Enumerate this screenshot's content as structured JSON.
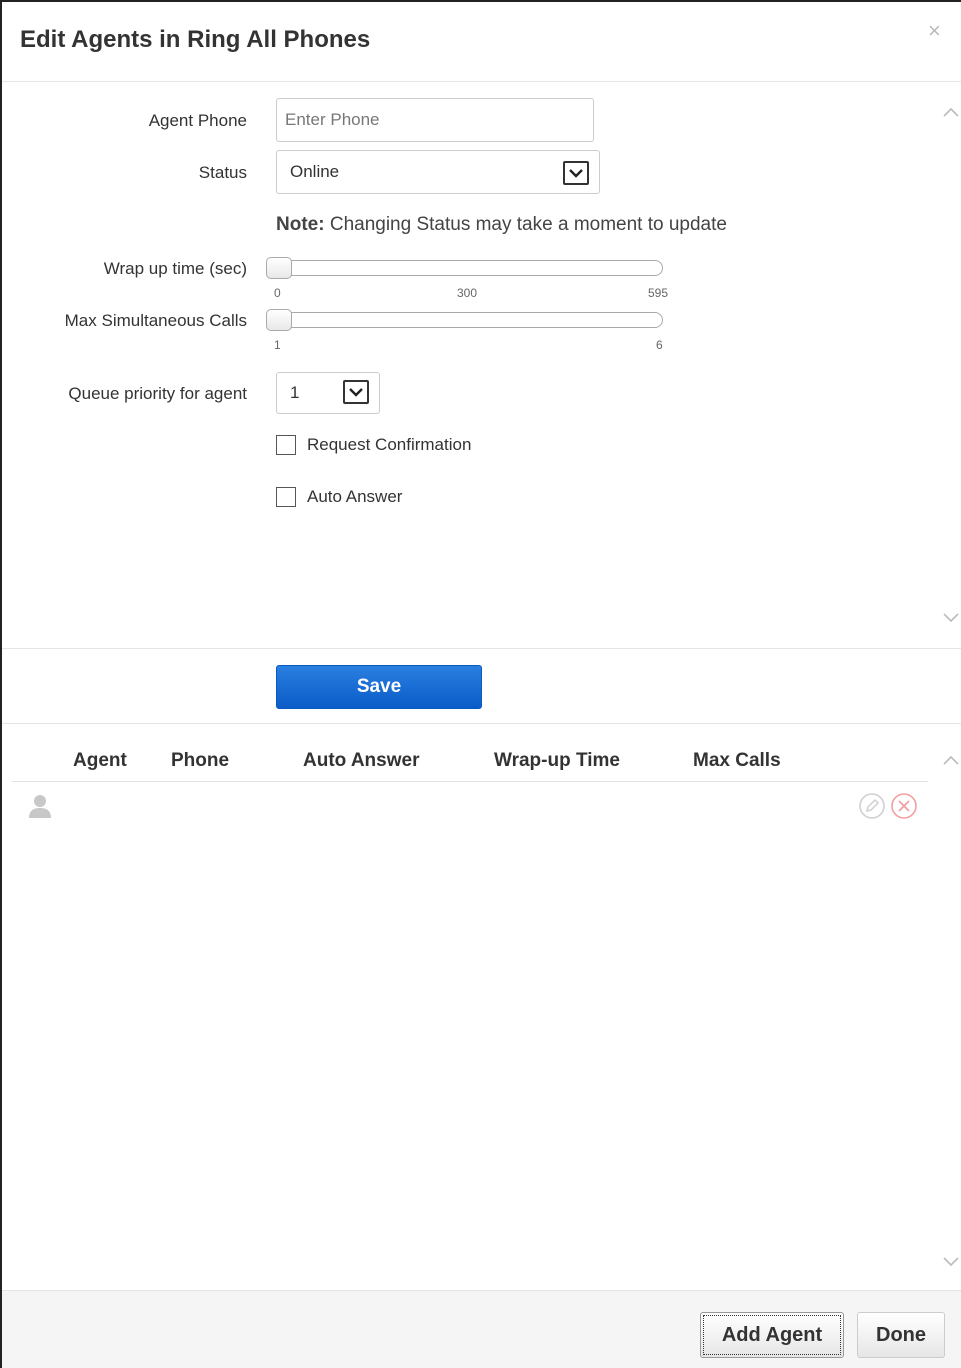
{
  "dialog": {
    "title": "Edit Agents in Ring All Phones",
    "close_glyph": "×"
  },
  "form": {
    "agent_phone": {
      "label": "Agent Phone",
      "value": "",
      "placeholder": "Enter Phone"
    },
    "status": {
      "label": "Status",
      "value": "Online"
    },
    "note": {
      "prefix": "Note:",
      "text": " Changing Status may take a moment to update"
    },
    "wrap_up": {
      "label": "Wrap up time (sec)",
      "value": 0,
      "ticks": [
        "0",
        "300",
        "595"
      ]
    },
    "max_calls": {
      "label": "Max Simultaneous Calls",
      "value": 1,
      "ticks": [
        "1",
        "6"
      ]
    },
    "queue_priority": {
      "label": "Queue priority for agent",
      "value": "1"
    },
    "request_confirmation": {
      "label": "Request Confirmation",
      "checked": false
    },
    "auto_answer": {
      "label": "Auto Answer",
      "checked": false
    },
    "save_label": "Save"
  },
  "table": {
    "columns": [
      "Agent",
      "Phone",
      "Auto Answer",
      "Wrap-up Time",
      "Max Calls"
    ],
    "rows": [
      {
        "icon": "user-avatar-icon",
        "actions": [
          "edit-icon",
          "delete-icon"
        ]
      }
    ]
  },
  "footer": {
    "add_agent_label": "Add Agent",
    "done_label": "Done"
  },
  "colors": {
    "primary_button": "#0b5cc8",
    "delete_icon": "#f0a0a0",
    "muted_icon": "#c8c8c8"
  }
}
